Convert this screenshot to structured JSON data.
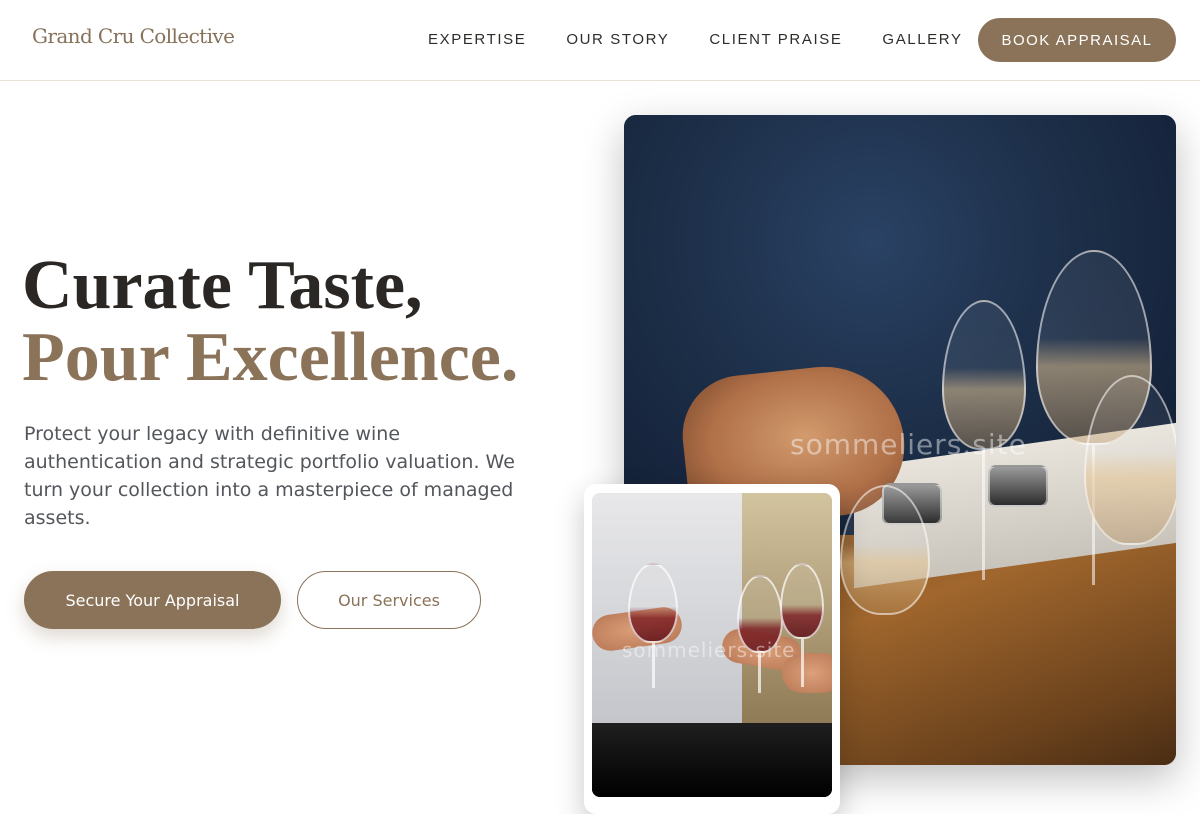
{
  "brand": {
    "logo_text": "Grand Cru Collective"
  },
  "nav": {
    "links": [
      "EXPERTISE",
      "OUR STORY",
      "CLIENT PRAISE",
      "GALLERY"
    ],
    "cta_label": "BOOK APPRAISAL"
  },
  "hero": {
    "title_line1": "Curate Taste,",
    "title_line2": "Pour Excellence.",
    "description": "Protect your legacy with definitive wine authentication and strategic portfolio valuation. We turn your collection into a masterpiece of managed assets.",
    "primary_button": "Secure Your Appraisal",
    "secondary_button": "Our Services"
  },
  "images": {
    "main_watermark": "sommeliers.site",
    "inset_watermark": "sommeliers.site"
  },
  "colors": {
    "accent": "#8a7358",
    "text_dark": "#2a2724",
    "text_body": "#53565b"
  }
}
